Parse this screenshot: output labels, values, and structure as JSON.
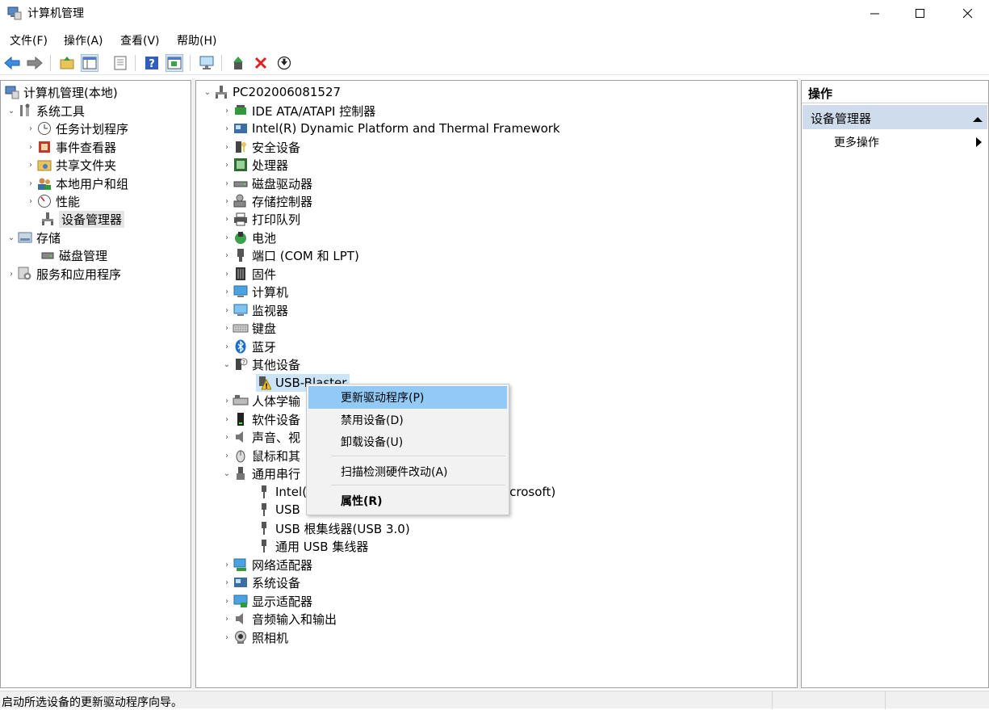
{
  "window": {
    "title": "计算机管理"
  },
  "menubar": [
    "文件(F)",
    "操作(A)",
    "查看(V)",
    "帮助(H)"
  ],
  "left_tree": {
    "root": "计算机管理(本地)",
    "system_tools": "系统工具",
    "items": [
      "任务计划程序",
      "事件查看器",
      "共享文件夹",
      "本地用户和组",
      "性能",
      "设备管理器"
    ],
    "storage": "存储",
    "disk_mgmt": "磁盘管理",
    "services": "服务和应用程序"
  },
  "device_tree": {
    "computer": "PC202006081527",
    "categories": [
      "IDE ATA/ATAPI 控制器",
      "Intel(R) Dynamic Platform and Thermal Framework",
      "安全设备",
      "处理器",
      "磁盘驱动器",
      "存储控制器",
      "打印队列",
      "电池",
      "端口 (COM 和 LPT)",
      "固件",
      "计算机",
      "监视器",
      "键盘",
      "蓝牙",
      "其他设备"
    ],
    "other_child": "USB-Blaster",
    "categories2": [
      "人体学输",
      "软件设备",
      "声音、视",
      "鼠标和其"
    ],
    "usb_controller": "通用串行",
    "usb_children": [
      "Intel(",
      "USB",
      "USB 根集线器(USB 3.0)",
      "通用 USB 集线器"
    ],
    "usb_child_tail": "icrosoft)",
    "categories3": [
      "网络适配器",
      "系统设备",
      "显示适配器",
      "音频输入和输出",
      "照相机"
    ]
  },
  "context_menu": {
    "items": [
      "更新驱动程序(P)",
      "禁用设备(D)",
      "卸载设备(U)",
      "扫描检测硬件改动(A)",
      "属性(R)"
    ],
    "highlighted": 0
  },
  "actions": {
    "title": "操作",
    "section": "设备管理器",
    "more": "更多操作"
  },
  "status": {
    "text": "启动所选设备的更新驱动程序向导。"
  },
  "colors": {
    "highlight": "#91c9f7",
    "section_bg": "#cfdcec",
    "selection": "#e5e5e5"
  }
}
